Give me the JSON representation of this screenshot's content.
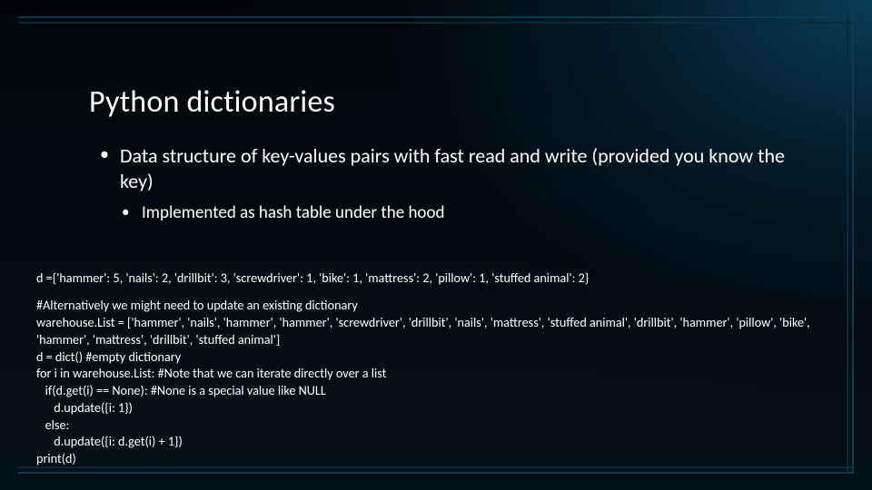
{
  "title": "Python dictionaries",
  "bullets": {
    "b1": "Data structure of key-values pairs with fast read and write (provided you know the key)",
    "b2": "Implemented as hash table under the hood"
  },
  "code": {
    "l1": "d ={'hammer': 5, 'nails': 2, 'drillbit': 3, 'screwdriver': 1, 'bike': 1, 'mattress': 2, 'pillow': 1, 'stuffed animal': 2}",
    "l2": "#Alternatively we might need to update an existing dictionary",
    "l3": "warehouse.List = ['hammer', 'nails', 'hammer', 'hammer', 'screwdriver', 'drillbit', 'nails', 'mattress', 'stuffed animal', 'drillbit', 'hammer', 'pillow', 'bike', 'hammer', 'mattress', 'drillbit', 'stuffed animal']",
    "l4": "d = dict() #empty dictionary",
    "l5": "for i in warehouse.List: #Note that we can iterate directly over a list",
    "l6": "   if(d.get(i) == None): #None is a special value like NULL",
    "l7": "      d.update({i: 1})",
    "l8": "   else:",
    "l9": "      d.update({i: d.get(i) + 1})",
    "l10": "print(d)"
  }
}
